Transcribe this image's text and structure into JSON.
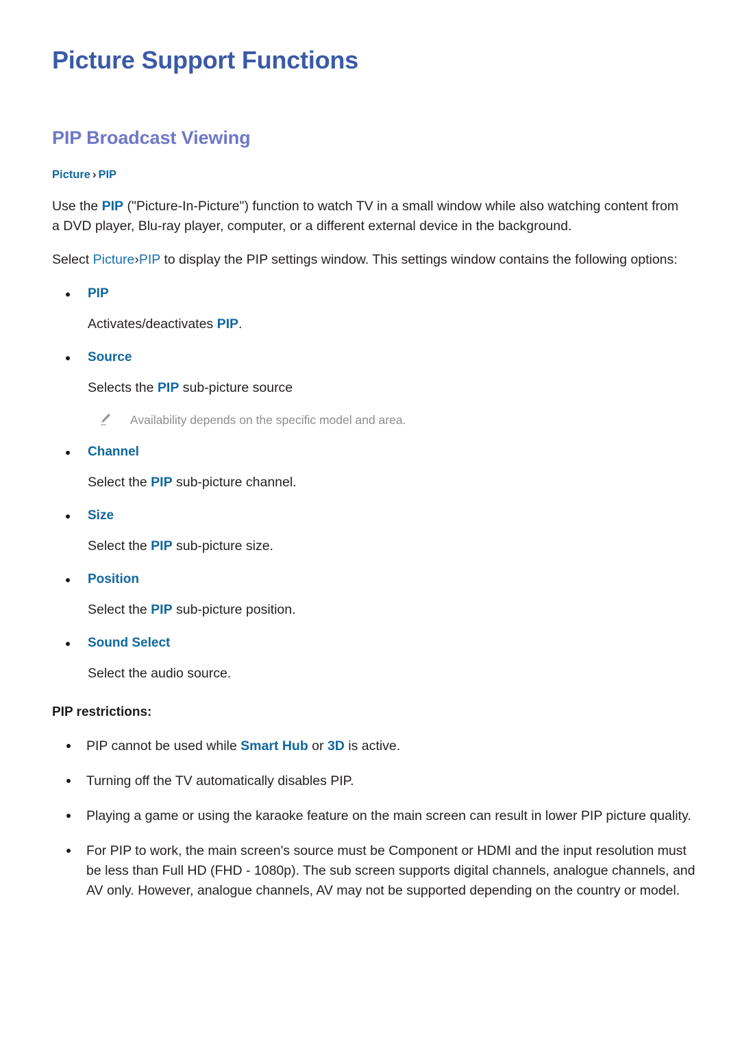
{
  "document": {
    "title": "Picture Support Functions",
    "section_title": "PIP Broadcast Viewing",
    "breadcrumb": {
      "first": "Picture",
      "separator": "›",
      "second": "PIP"
    },
    "intro": {
      "line1_a": "Use the ",
      "line1_pip": "PIP",
      "line1_b": " (\"Picture-In-Picture\") function to watch TV in a small window while also watching content from a DVD player, Blu-ray player, computer, or a different external device in the background.",
      "line2_a": "Select ",
      "line2_picture": "Picture",
      "line2_sep": "›",
      "line2_pip": "PIP",
      "line2_b": " to display the PIP settings window. This settings window contains the following options:"
    },
    "options": [
      {
        "label": "PIP",
        "desc_a": "Activates/deactivates ",
        "desc_accent": "PIP",
        "desc_b": ".",
        "note": null
      },
      {
        "label": "Source",
        "desc_a": "Selects the ",
        "desc_accent": "PIP",
        "desc_b": " sub-picture source",
        "note": {
          "icon": "pencil-icon",
          "text": "Availability depends on the specific model and area."
        }
      },
      {
        "label": "Channel",
        "desc_a": "Select the ",
        "desc_accent": "PIP",
        "desc_b": " sub-picture channel.",
        "note": null
      },
      {
        "label": "Size",
        "desc_a": "Select the ",
        "desc_accent": "PIP",
        "desc_b": " sub-picture size.",
        "note": null
      },
      {
        "label": "Position",
        "desc_a": "Select the ",
        "desc_accent": "PIP",
        "desc_b": " sub-picture position.",
        "note": null
      },
      {
        "label": "Sound Select",
        "desc_a": "Select the audio source.",
        "desc_accent": "",
        "desc_b": "",
        "note": null
      }
    ],
    "restrictions_heading": "PIP restrictions:",
    "restrictions": [
      {
        "part_a": "PIP cannot be used while ",
        "accent_1": "Smart Hub",
        "part_b": " or ",
        "accent_2": "3D",
        "part_c": " is active."
      },
      {
        "part_a": "Turning off the TV automatically disables PIP.",
        "accent_1": "",
        "part_b": "",
        "accent_2": "",
        "part_c": ""
      },
      {
        "part_a": "Playing a game or using the karaoke feature on the main screen can result in lower PIP picture quality.",
        "accent_1": "",
        "part_b": "",
        "accent_2": "",
        "part_c": ""
      },
      {
        "part_a": "For PIP to work, the main screen's source must be Component or HDMI and the input resolution must be less than Full HD (FHD - 1080p). The sub screen supports digital channels, analogue channels, and AV only. However, analogue channels, AV may not be supported depending on the country or model.",
        "accent_1": "",
        "part_b": "",
        "accent_2": "",
        "part_c": ""
      }
    ],
    "colors": {
      "title_blue": "#3a5aa6",
      "section_blue": "#6f77c6",
      "accent_blue": "#10679f",
      "body_text": "#231f20",
      "note_gray": "#8d8d8d",
      "background": "#ffffff"
    }
  }
}
